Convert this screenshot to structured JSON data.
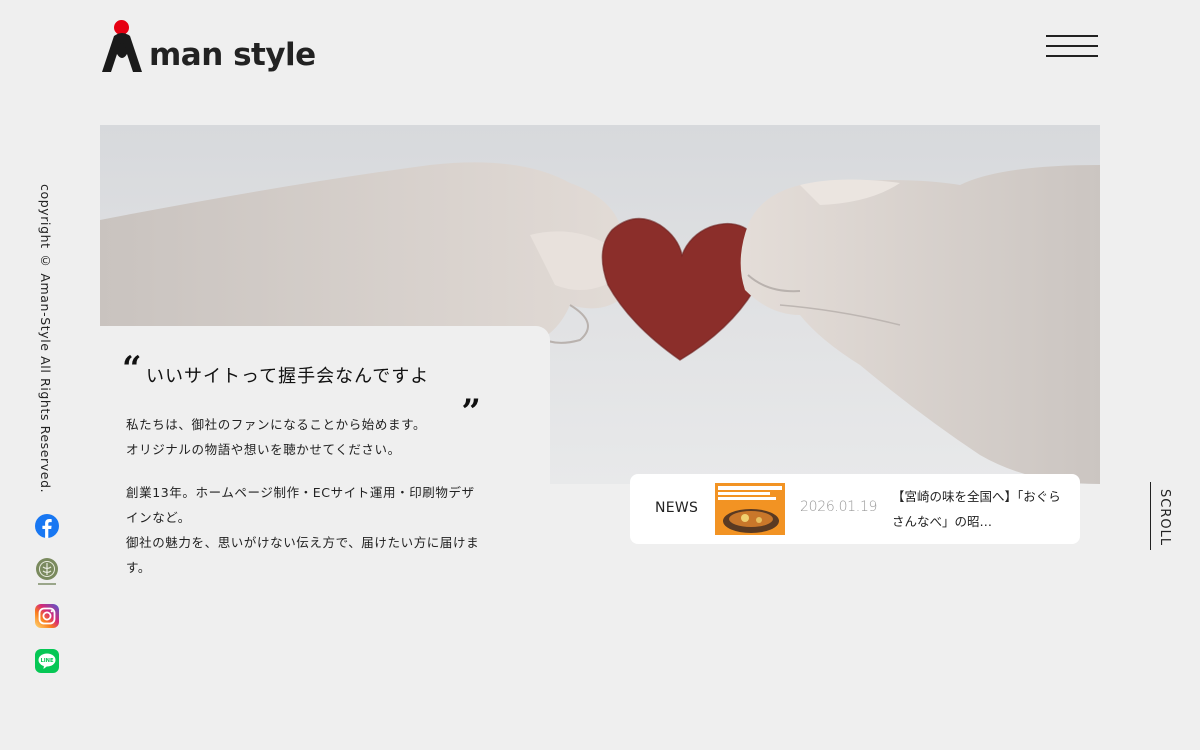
{
  "brand": {
    "name": "man style",
    "accent": "#e60012"
  },
  "nav": {
    "menu_icon": "hamburger-menu-icon"
  },
  "sidebar": {
    "copyright": "copyright © Aman-Style All Rights Reserved.",
    "social": [
      {
        "name": "facebook-icon",
        "color": "#1877f2"
      },
      {
        "name": "instagram-icon",
        "color": "#e1306c"
      },
      {
        "name": "line-icon",
        "color": "#06c755"
      }
    ]
  },
  "hero": {
    "tagline": "いいサイトって握手会なんですよ",
    "quote_open": "“",
    "quote_close": "„",
    "intro_lines": [
      "私たちは、御社のファンになることから始めます。",
      "オリジナルの物語や想いを聴かせてください。"
    ],
    "body_lines": [
      "創業13年。ホームページ制作・ECサイト運用・印刷物デザ",
      "インなど。",
      "御社の魅力を、思いがけない伝え方で、届けたい方に届けま",
      "す。"
    ]
  },
  "news": {
    "label": "NEWS",
    "date": "2026.01.19",
    "title": "【宮崎の味を全国へ】「おぐらさんなべ」の昭…"
  },
  "scroll": {
    "label": "SCROLL"
  }
}
